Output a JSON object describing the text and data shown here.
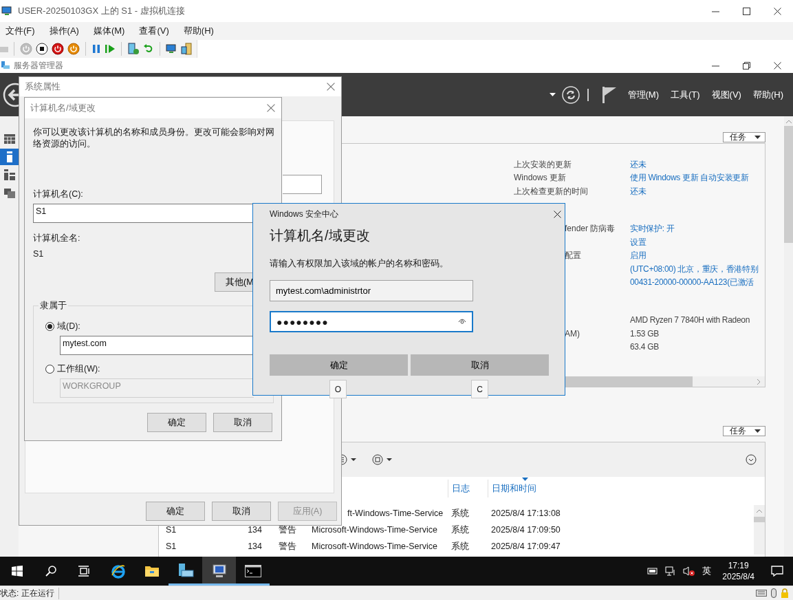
{
  "window": {
    "title": "USER-20250103GX 上的 S1 - 虚拟机连接"
  },
  "menu": [
    "文件(F)",
    "操作(A)",
    "媒体(M)",
    "查看(V)",
    "帮助(H)"
  ],
  "server_manager": {
    "title": "服务器管理器",
    "header_menu": [
      "管理(M)",
      "工具(T)",
      "视图(V)",
      "帮助(H)"
    ],
    "sidebar": [
      {
        "kind": "dashboard",
        "selected": false
      },
      {
        "kind": "local-server",
        "selected": true
      },
      {
        "kind": "all-servers",
        "selected": false
      },
      {
        "kind": "file-services",
        "selected": false
      }
    ],
    "properties": {
      "tasks": "任务",
      "groups": [
        {
          "rows": [
            {
              "label": "上次安装的更新",
              "value": "还未",
              "link": true
            },
            {
              "label": "Windows 更新",
              "value": "使用 Windows 更新 自动安装更新",
              "link": true
            },
            {
              "label": "上次检查更新的时间",
              "value": "还未",
              "link": true
            }
          ]
        },
        {
          "rows": [
            {
              "label": "fender 防病毒",
              "covered": true,
              "value": "实时保护: 开",
              "link": true
            },
            {
              "value": "设置",
              "link": true
            },
            {
              "label": "配置",
              "covered": true,
              "value": "启用",
              "link": true
            },
            {
              "value": "(UTC+08:00) 北京，重庆，香港特别",
              "link": true
            },
            {
              "value": "00431-20000-00000-AA123(已激活",
              "link": true
            }
          ]
        },
        {
          "rows": [
            {
              "value": "AMD Ryzen 7 7840H with Radeon",
              "link": false
            },
            {
              "label": "AM)",
              "covered": true,
              "value": "1.53 GB",
              "link": false
            },
            {
              "value": "63.4 GB",
              "link": false
            }
          ]
        }
      ]
    },
    "events": {
      "tasks": "任务",
      "columns": [
        "日志",
        "日期和时间"
      ],
      "rows": [
        {
          "covered": true,
          "source": "ft-Windows-Time-Service",
          "log": "系统",
          "datetime": "2025/8/4 17:13:08"
        },
        {
          "server": "S1",
          "id": "134",
          "level": "警告",
          "source": "Microsoft-Windows-Time-Service",
          "log": "系统",
          "datetime": "2025/8/4 17:09:50"
        },
        {
          "server": "S1",
          "id": "134",
          "level": "警告",
          "source": "Microsoft-Windows-Time-Service",
          "log": "系统",
          "datetime": "2025/8/4 17:09:47"
        }
      ]
    }
  },
  "system_properties": {
    "title": "系统属性",
    "buttons": [
      {
        "label": "确定",
        "disabled": false
      },
      {
        "label": "取消",
        "disabled": false
      },
      {
        "label": "应用(A)",
        "disabled": true
      }
    ]
  },
  "name_dialog": {
    "title": "计算机名/域更改",
    "description": "你可以更改该计算机的名称和成员身份。更改可能会影响对网络资源的访问。",
    "name_label": "计算机名(C):",
    "name_value": "S1",
    "full_name_label": "计算机全名:",
    "full_name": "S1",
    "more_button": "其他(M",
    "member_of": "隶属于",
    "options": [
      {
        "label": "域(D):",
        "selected": true,
        "value": "mytest.com"
      },
      {
        "label": "工作组(W):",
        "selected": false,
        "value": "WORKGROUP"
      }
    ],
    "buttons": [
      "确定",
      "取消"
    ]
  },
  "security_dialog": {
    "caption": "Windows 安全中心",
    "heading": "计算机名/域更改",
    "prompt": "请输入有权限加入该域的帐户的名称和密码。",
    "username": "mytest.com\\administrtor",
    "password": "●●●●●●●●",
    "buttons": [
      {
        "label": "确定",
        "access_key": "O"
      },
      {
        "label": "取消",
        "access_key": "C"
      }
    ]
  },
  "taskbar": {
    "apps": [
      {
        "kind": "ie",
        "running": false,
        "selected": false
      },
      {
        "kind": "explorer",
        "running": false,
        "selected": false
      },
      {
        "kind": "server-manager",
        "running": true,
        "selected": false
      },
      {
        "kind": "vm-connect",
        "running": true,
        "selected": true
      },
      {
        "kind": "cmd",
        "running": true,
        "selected": false
      }
    ],
    "language": "英",
    "time": "17:19",
    "date": "2025/8/4"
  },
  "status_bar": {
    "text": "状态: 正在运行"
  }
}
